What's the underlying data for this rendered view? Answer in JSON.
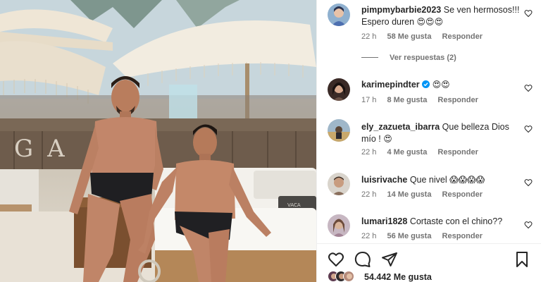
{
  "photo": {
    "sign_text": "GA DE",
    "sign_text_right": "VACA"
  },
  "comments": [
    {
      "username": "pimpmybarbie2023",
      "text": "Se ven hermosos!!! Espero duren",
      "emoji": "😍😍😍",
      "time": "22 h",
      "likes": "58 Me gusta",
      "reply": "Responder",
      "view_replies": "Ver respuestas (2)"
    },
    {
      "username": "karimepindter",
      "text": "",
      "emoji": "😍😍",
      "time": "17 h",
      "likes": "8 Me gusta",
      "reply": "Responder"
    },
    {
      "username": "ely_zazueta_ibarra",
      "text": "Que belleza Dios mío !",
      "emoji": "😍",
      "time": "22 h",
      "likes": "4 Me gusta",
      "reply": "Responder"
    },
    {
      "username": "luisrivache",
      "text": "Que nivel",
      "emoji": "😱😱😱😱",
      "time": "22 h",
      "likes": "14 Me gusta",
      "reply": "Responder"
    },
    {
      "username": "lumari1828",
      "text": "Cortaste con el chino??",
      "emoji": "",
      "time": "22 h",
      "likes": "56 Me gusta",
      "reply": "Responder"
    }
  ],
  "actions": {
    "like": "heart-icon",
    "comment": "comment-icon",
    "share": "share-icon",
    "save": "bookmark-icon"
  },
  "like_count": "54.442 Me gusta",
  "colors": {
    "text": "#262626",
    "secondary": "#737373",
    "verified": "#0095f6",
    "divider": "#efefef"
  }
}
